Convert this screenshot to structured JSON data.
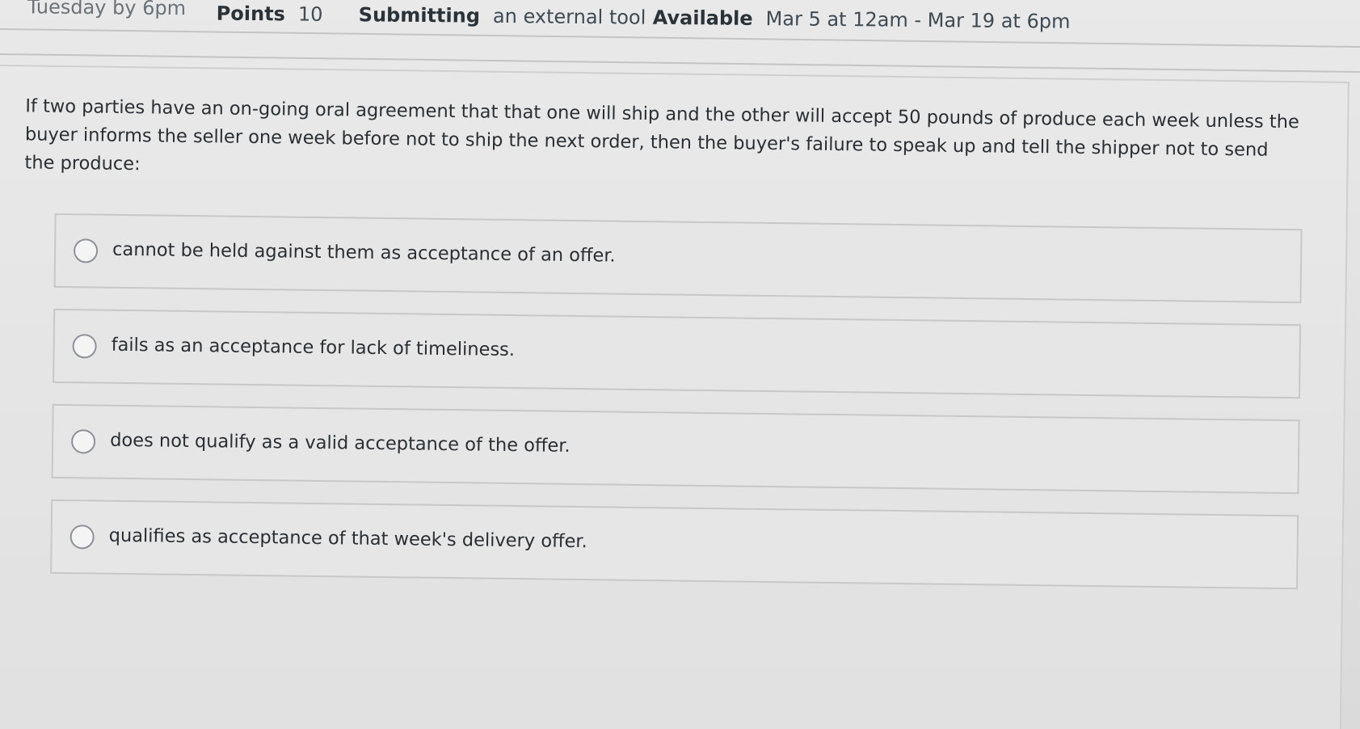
{
  "header": {
    "due_text": "Tuesday by 6pm",
    "points_label": "Points",
    "points_value": "10",
    "submitting_label": "Submitting",
    "submitting_value": "an external tool",
    "available_label": "Available",
    "available_value": "Mar 5 at 12am - Mar 19 at 6pm"
  },
  "question": {
    "text": "If two parties have an on-going oral agreement that that one will ship and the other will accept 50 pounds of produce each week unless the buyer informs the seller one week before not to ship the next order, then the buyer's failure to speak up and tell the shipper not to send the produce:",
    "answers": [
      {
        "label": "cannot be held against them as acceptance of an offer."
      },
      {
        "label": "fails as an acceptance for lack of timeliness."
      },
      {
        "label": "does not qualify as a valid acceptance of the offer."
      },
      {
        "label": "qualifies as acceptance of that week's delivery offer."
      }
    ]
  }
}
